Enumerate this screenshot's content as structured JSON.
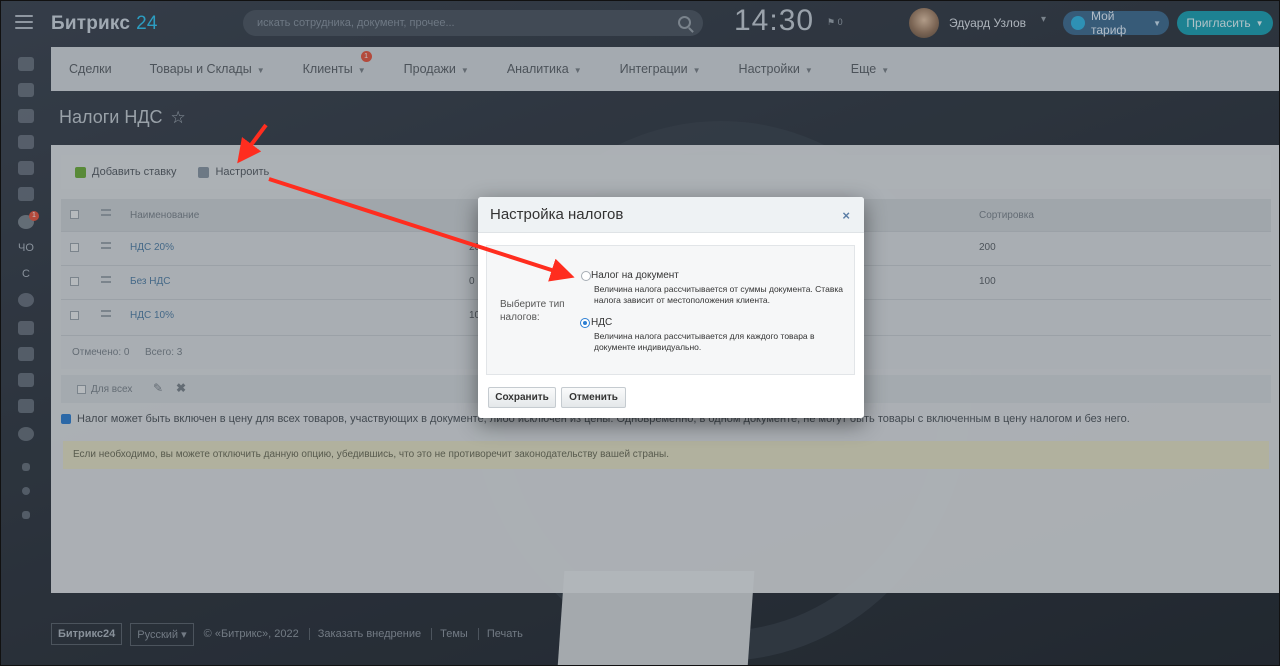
{
  "app": {
    "logo_main": "Битрикс",
    "logo_num": "24"
  },
  "header": {
    "search_placeholder": "искать сотрудника, документ, прочее...",
    "clock": "14:30",
    "flag_count": "0",
    "user_name": "Эдуард Узлов",
    "plan_label": "Мой тариф",
    "invite_label": "Пригласить"
  },
  "sidebar": {
    "items": [
      {
        "label": "ЧО"
      },
      {
        "label": "С"
      }
    ],
    "badge": "1"
  },
  "nav": {
    "items": [
      {
        "label": "Сделки"
      },
      {
        "label": "Товары и Склады"
      },
      {
        "label": "Клиенты"
      },
      {
        "label": "Продажи"
      },
      {
        "label": "Аналитика"
      },
      {
        "label": "Интеграции"
      },
      {
        "label": "Настройки"
      },
      {
        "label": "Еще"
      }
    ],
    "clients_badge": "1"
  },
  "page": {
    "title": "Налоги НДС"
  },
  "toolbar": {
    "add_label": "Добавить ставку",
    "config_label": "Настроить"
  },
  "table": {
    "headers": {
      "name": "Наименование",
      "sort": "Сортировка"
    },
    "rows": [
      {
        "name": "НДС 20%",
        "rate": "20",
        "sort": "200"
      },
      {
        "name": "Без НДС",
        "rate": "0",
        "sort": "100"
      },
      {
        "name": "НДС 10%",
        "rate": "10",
        "sort": ""
      }
    ],
    "footer": {
      "checked": "Отмечено: 0",
      "total": "Всего: 3"
    }
  },
  "actions": {
    "for_all": "Для всех"
  },
  "settings": {
    "include_tax_text": "Налог может быть включен в цену для всех товаров, участвующих в документе, либо исключен из цены. Одновременно, в одном документе, не могут быть товары с включенным в цену налогом и без него.",
    "note": "Если необходимо, вы можете отключить данную опцию, убедившись, что это не противоречит законодательству вашей страны."
  },
  "footer": {
    "logo": "Битрикс24",
    "language": "Русский",
    "copyright": "© «Битрикс», 2022",
    "order": "Заказать внедрение",
    "themes": "Темы",
    "print": "Печать"
  },
  "modal": {
    "title": "Настройка налогов",
    "close": "×",
    "type_label": "Выберите тип налогов:",
    "options": [
      {
        "label": "Налог на документ",
        "desc": "Величина налога рассчитывается от суммы документа. Ставка налога зависит от местоположения клиента.",
        "selected": false
      },
      {
        "label": "НДС",
        "desc": "Величина налога рассчитывается для каждого товара в документе индивидуально.",
        "selected": true
      }
    ],
    "save": "Сохранить",
    "cancel": "Отменить"
  },
  "colors": {
    "accent": "#2fc6f6",
    "invite": "#1aa2b6",
    "annotation": "#ff2d1f",
    "selected_radio": "#2d7fd3"
  }
}
